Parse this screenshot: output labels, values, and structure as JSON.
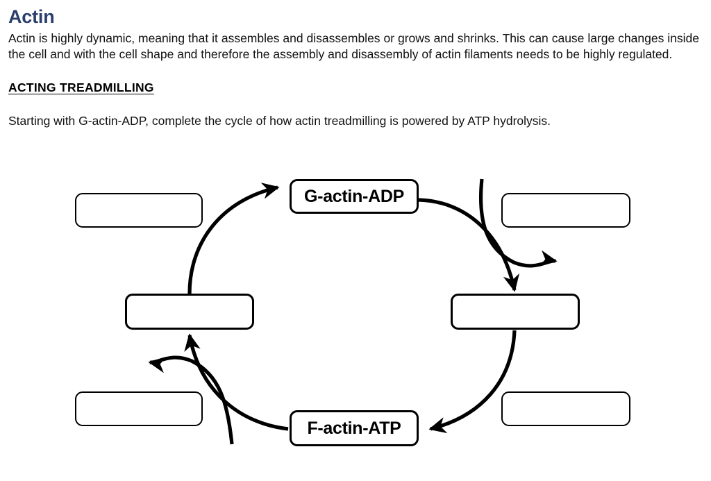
{
  "document": {
    "title": "Actin",
    "title_color": "#2b3f6c",
    "intro_paragraph": "Actin is highly dynamic, meaning that it assembles and disassembles or grows and shrinks. This can cause large changes inside the cell and with the cell shape and therefore the assembly and disassembly of actin filaments needs to be highly regulated.",
    "section_heading": "ACTING TREADMILLING",
    "instruction": "Starting with G-actin-ADP, complete the cycle of how actin treadmilling is powered by ATP hydrolysis."
  },
  "diagram": {
    "type": "cycle-diagram",
    "stroke_color": "#000000",
    "background_color": "#ffffff",
    "nodes": [
      {
        "id": "top-center",
        "label": "G-actin-ADP",
        "filled": true,
        "position": "top-center"
      },
      {
        "id": "bottom-center",
        "label": "F-actin-ATP",
        "filled": true,
        "position": "bottom-center"
      },
      {
        "id": "top-left",
        "label": "",
        "filled": false,
        "position": "top-left"
      },
      {
        "id": "top-right",
        "label": "",
        "filled": false,
        "position": "top-right"
      },
      {
        "id": "mid-left",
        "label": "",
        "filled": false,
        "position": "mid-left"
      },
      {
        "id": "mid-right",
        "label": "",
        "filled": false,
        "position": "mid-right"
      },
      {
        "id": "bottom-left",
        "label": "",
        "filled": false,
        "position": "bottom-left"
      },
      {
        "id": "bottom-right",
        "label": "",
        "filled": false,
        "position": "bottom-right"
      }
    ],
    "arrows": [
      {
        "id": "arc-left-up",
        "from": "mid-left",
        "to": "top-center",
        "direction": "clockwise"
      },
      {
        "id": "arc-right-down",
        "from": "top-center",
        "to": "mid-right",
        "direction": "clockwise"
      },
      {
        "id": "arc-right-bottom",
        "from": "mid-right",
        "to": "bottom-center",
        "direction": "clockwise"
      },
      {
        "id": "arc-left-bottom",
        "from": "bottom-center",
        "to": "mid-left",
        "direction": "clockwise"
      },
      {
        "id": "branch-top-right",
        "from": "top-right",
        "to": "outward-right",
        "direction": "outward"
      },
      {
        "id": "branch-bottom-left",
        "from": "bottom-left",
        "to": "outward-left",
        "direction": "outward"
      }
    ]
  }
}
